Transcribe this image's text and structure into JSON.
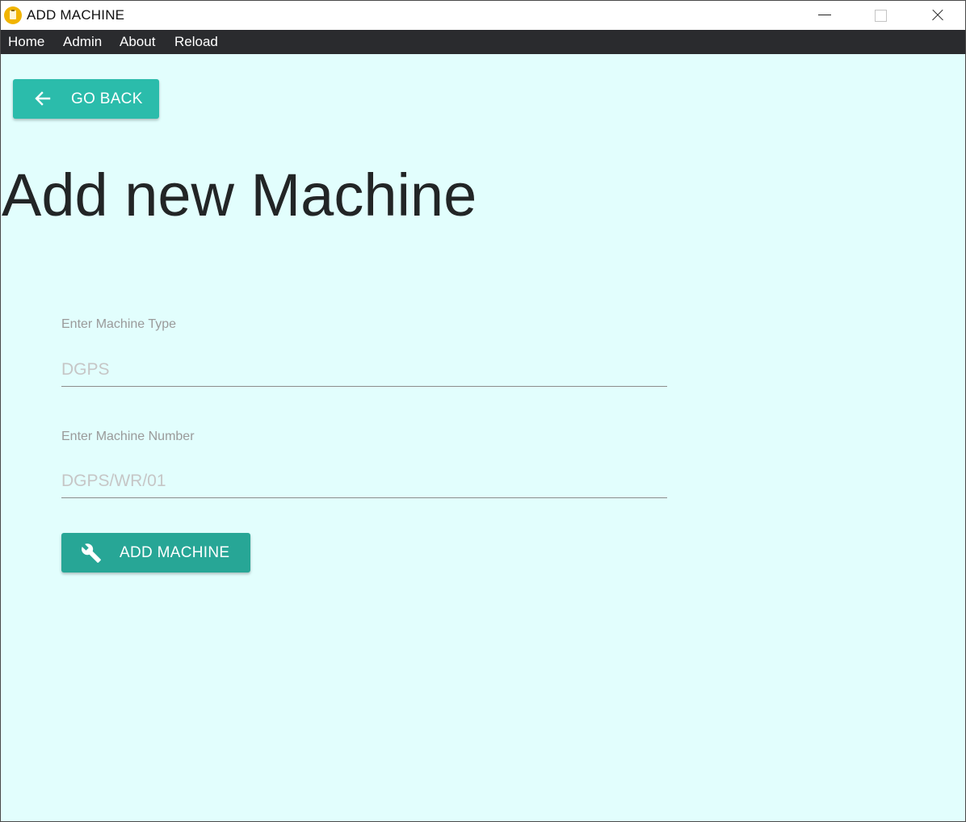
{
  "window": {
    "title": "ADD MACHINE"
  },
  "menu": {
    "items": [
      {
        "label": "Home"
      },
      {
        "label": "Admin"
      },
      {
        "label": "About"
      },
      {
        "label": "Reload"
      }
    ]
  },
  "back_button": {
    "label": "GO BACK",
    "icon": "arrow-left-icon"
  },
  "page": {
    "title": "Add new Machine"
  },
  "form": {
    "machine_type": {
      "label": "Enter Machine Type",
      "placeholder": "DGPS",
      "value": ""
    },
    "machine_number": {
      "label": "Enter Machine Number",
      "placeholder": "DGPS/WR/01",
      "value": ""
    },
    "submit": {
      "label": "ADD MACHINE",
      "icon": "wrench-icon"
    }
  },
  "colors": {
    "background": "#e2fefd",
    "menubar": "#2a2b2e",
    "back_button": "#2bbcab",
    "add_button": "#27a696",
    "app_icon": "#f1b400"
  }
}
